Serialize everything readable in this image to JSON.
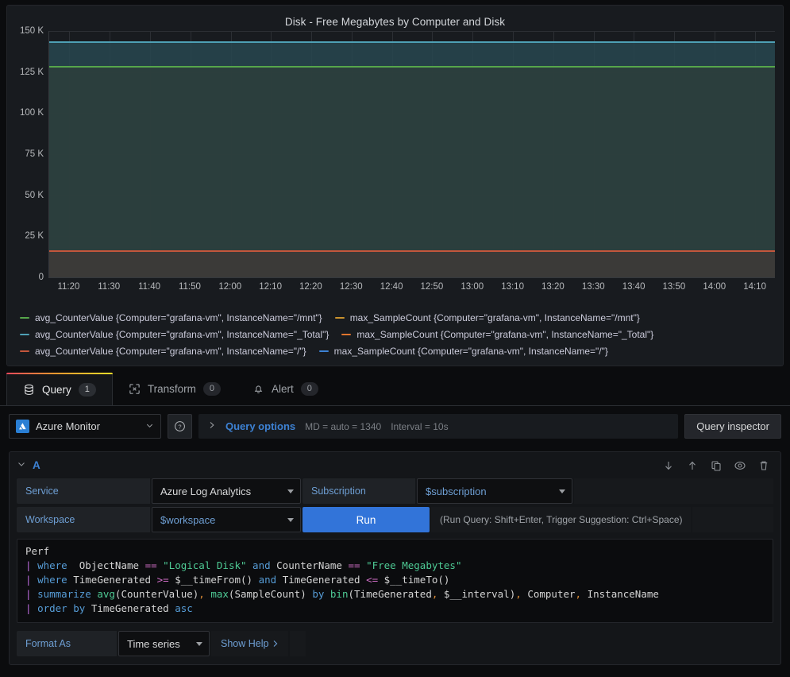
{
  "panel": {
    "title": "Disk - Free Megabytes by Computer and Disk",
    "y_ticks": [
      "150 K",
      "125 K",
      "100 K",
      "75 K",
      "50 K",
      "25 K",
      "0"
    ],
    "x_ticks": [
      "11:20",
      "11:30",
      "11:40",
      "11:50",
      "12:00",
      "12:10",
      "12:20",
      "12:30",
      "12:40",
      "12:50",
      "13:00",
      "13:10",
      "13:20",
      "13:30",
      "13:40",
      "13:50",
      "14:00",
      "14:10"
    ],
    "legend": [
      {
        "label": "avg_CounterValue {Computer=\"grafana-vm\", InstanceName=\"/mnt\"}",
        "color": "#56a64b"
      },
      {
        "label": "max_SampleCount {Computer=\"grafana-vm\", InstanceName=\"/mnt\"}",
        "color": "#c9922e"
      },
      {
        "label": "avg_CounterValue {Computer=\"grafana-vm\", InstanceName=\"_Total\"}",
        "color": "#4ea0b5"
      },
      {
        "label": "max_SampleCount {Computer=\"grafana-vm\", InstanceName=\"_Total\"}",
        "color": "#e0752d"
      },
      {
        "label": "avg_CounterValue {Computer=\"grafana-vm\", InstanceName=\"/\"}",
        "color": "#c4563c"
      },
      {
        "label": "max_SampleCount {Computer=\"grafana-vm\", InstanceName=\"/\"}",
        "color": "#3d82d4"
      }
    ]
  },
  "chart_data": {
    "type": "line",
    "title": "Disk - Free Megabytes by Computer and Disk",
    "xlabel": "",
    "ylabel": "",
    "ylim": [
      0,
      150000
    ],
    "xlim": [
      "11:15",
      "14:15"
    ],
    "grid": true,
    "legend_position": "bottom",
    "ytick_values": [
      0,
      25000,
      50000,
      75000,
      100000,
      125000,
      150000
    ],
    "ytick_labels": [
      "0",
      "25 K",
      "50 K",
      "75 K",
      "100 K",
      "125 K",
      "150 K"
    ],
    "x": [
      "11:20",
      "11:30",
      "11:40",
      "11:50",
      "12:00",
      "12:10",
      "12:20",
      "12:30",
      "12:40",
      "12:50",
      "13:00",
      "13:10",
      "13:20",
      "13:30",
      "13:40",
      "13:50",
      "14:00",
      "14:10"
    ],
    "series": [
      {
        "name": "avg_CounterValue {Computer=\"grafana-vm\", InstanceName=\"_Total\"}",
        "color": "#4ea0b5",
        "values": [
          143000,
          143000,
          143000,
          143000,
          143000,
          143000,
          143000,
          143000,
          143000,
          143000,
          143000,
          143000,
          143000,
          143000,
          143000,
          143000,
          143000,
          143000
        ]
      },
      {
        "name": "avg_CounterValue {Computer=\"grafana-vm\", InstanceName=\"/mnt\"}",
        "color": "#56a64b",
        "values": [
          128000,
          128000,
          128000,
          128000,
          128000,
          128000,
          128000,
          128000,
          128000,
          128000,
          128000,
          128000,
          128000,
          128000,
          128000,
          128000,
          128000,
          128000
        ]
      },
      {
        "name": "avg_CounterValue {Computer=\"grafana-vm\", InstanceName=\"/\"}",
        "color": "#c4563c",
        "values": [
          16000,
          16000,
          16000,
          16000,
          16000,
          16000,
          16000,
          16000,
          16000,
          16000,
          16000,
          16000,
          16000,
          16000,
          16000,
          16000,
          16000,
          16000
        ]
      },
      {
        "name": "max_SampleCount {Computer=\"grafana-vm\", InstanceName=\"/mnt\"}",
        "color": "#c9922e",
        "values": [
          1,
          1,
          1,
          1,
          1,
          1,
          1,
          1,
          1,
          1,
          1,
          1,
          1,
          1,
          1,
          1,
          1,
          1
        ]
      },
      {
        "name": "max_SampleCount {Computer=\"grafana-vm\", InstanceName=\"_Total\"}",
        "color": "#e0752d",
        "values": [
          1,
          1,
          1,
          1,
          1,
          1,
          1,
          1,
          1,
          1,
          1,
          1,
          1,
          1,
          1,
          1,
          1,
          1
        ]
      },
      {
        "name": "max_SampleCount {Computer=\"grafana-vm\", InstanceName=\"/\"}",
        "color": "#3d82d4",
        "values": [
          1,
          1,
          1,
          1,
          1,
          1,
          1,
          1,
          1,
          1,
          1,
          1,
          1,
          1,
          1,
          1,
          1,
          1
        ]
      }
    ]
  },
  "tabs": [
    {
      "label": "Query",
      "badge": "1",
      "icon": "database-icon",
      "active": true
    },
    {
      "label": "Transform",
      "badge": "0",
      "icon": "transform-icon",
      "active": false
    },
    {
      "label": "Alert",
      "badge": "0",
      "icon": "bell-icon",
      "active": false
    }
  ],
  "datasource": {
    "name": "Azure Monitor",
    "help_icon": "help-circle-icon",
    "query_options_label": "Query options",
    "md_text": "MD = auto = 1340",
    "interval_text": "Interval = 10s",
    "query_inspector_label": "Query inspector"
  },
  "query": {
    "ref_id": "A",
    "actions": [
      "move-down-icon",
      "move-up-icon",
      "duplicate-icon",
      "hide-icon",
      "remove-icon"
    ],
    "service_label": "Service",
    "service_value": "Azure Log Analytics",
    "subscription_label": "Subscription",
    "subscription_value": "$subscription",
    "workspace_label": "Workspace",
    "workspace_value": "$workspace",
    "run_label": "Run",
    "run_hint": "(Run Query: Shift+Enter, Trigger Suggestion: Ctrl+Space)",
    "code_lines": [
      "Perf",
      "| where  ObjectName == \"Logical Disk\" and CounterName == \"Free Megabytes\"",
      "| where TimeGenerated >= $__timeFrom() and TimeGenerated <= $__timeTo()",
      "| summarize avg(CounterValue), max(SampleCount) by bin(TimeGenerated, $__interval), Computer, InstanceName",
      "| order by TimeGenerated asc"
    ],
    "format_as_label": "Format As",
    "format_as_value": "Time series",
    "show_help_label": "Show Help"
  }
}
